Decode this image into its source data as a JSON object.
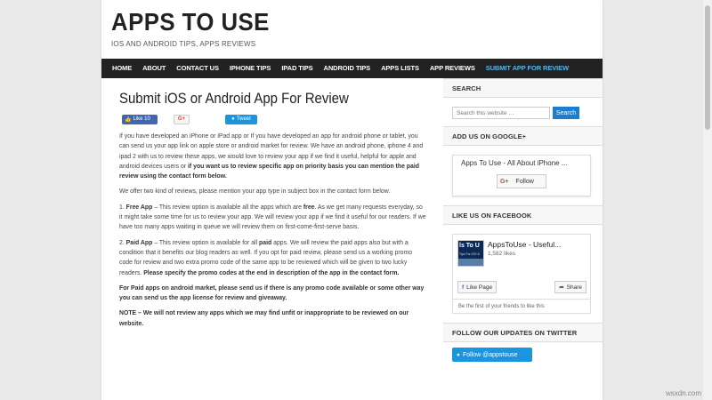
{
  "site": {
    "title": "APPS TO USE",
    "tagline": "IOS AND ANDROID TIPS, APPS REVIEWS"
  },
  "nav": {
    "items": [
      "HOME",
      "ABOUT",
      "CONTACT US",
      "IPHONE TIPS",
      "IPAD TIPS",
      "ANDROID TIPS",
      "APPS LISTS",
      "APP REVIEWS",
      "SUBMIT APP FOR REVIEW"
    ],
    "active_index": 8
  },
  "post": {
    "title": "Submit iOS or Android App For Review",
    "social": {
      "like": "Like 10",
      "gplus": "G+",
      "tweet": "Tweet"
    },
    "p1_a": "If you have developed an iPhone or iPad app or If you have developed an app for android phone or tablet, you can send us your app link on apple store or android market for review.  We have an android phone, iphone 4 and ipad 2 with us to review these apps, we would love to review your app if we find it useful, helpful for apple and android devices users or ",
    "p1_b": "if you want us to review specific app on priority basis you can mention the paid review using the contact form below.",
    "p2": "We offer two kind of reviews, please mention your app type in subject box in the contact form below.",
    "p3_num": "1. ",
    "p3_label": "Free App",
    "p3_a": " – This review option is available all the apps which are ",
    "p3_free": "free",
    "p3_b": ". As we get many requests everyday, so it might take some time for us to review your app. We will review your app if we find it useful for our readers. If we have too many apps waiting in queue we will review them on first-come-first-serve basis.",
    "p4_num": "2. ",
    "p4_label": "Paid App",
    "p4_a": " – This review option is available for all ",
    "p4_paid": "paid",
    "p4_b": " apps. We will review the paid apps also but with a condition that it benefits our blog readers as well. If you opt for paid review, please send us a working promo code for review and two extra promo code of the same app to be reviewed which will be given to two lucky readers. ",
    "p4_c": "Please specify the promo codes at the end in description of the app in the contact form.",
    "p5": "For Paid apps on android market, please send us if there is any promo code available or some other way you can send us the app license for review and giveaway.",
    "p6": "NOTE – We will not review any apps which we may find unfit or inappropriate to be reviewed on our website."
  },
  "sidebar": {
    "search": {
      "heading": "SEARCH",
      "placeholder": "Search this website …",
      "button": "Search"
    },
    "gplus": {
      "heading": "ADD US ON GOOGLE+",
      "card_title": "Apps To Use - All About iPhone ...",
      "g": "G+",
      "follow": "Follow"
    },
    "facebook": {
      "heading": "LIKE US ON FACEBOOK",
      "thumb_line1": "ls To U",
      "thumb_line2": "Tips For iOS &",
      "page_name": "AppsToUse - Useful...",
      "likes": "1,582 likes",
      "like_page": "Like Page",
      "share": "Share",
      "footer": "Be the first of your friends to like this"
    },
    "twitter": {
      "heading": "FOLLOW OUR UPDATES ON TWITTER",
      "follow": "Follow @appstouse"
    }
  },
  "watermark": "wsxdn.com"
}
